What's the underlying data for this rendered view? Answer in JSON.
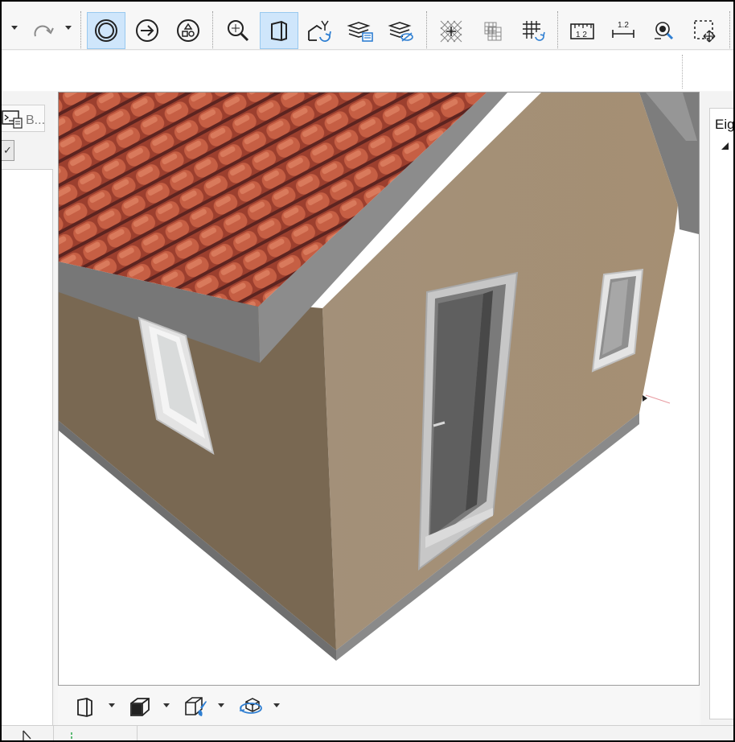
{
  "toolbar": {
    "buttons": [
      {
        "name": "redo-button",
        "icon": "redo-icon"
      },
      {
        "name": "select-circle-button",
        "icon": "circle-select-icon",
        "active": true
      },
      {
        "name": "arrow-action-button",
        "icon": "arrow-circle-icon"
      },
      {
        "name": "shapes-button",
        "icon": "shapes-icon"
      },
      {
        "name": "zoom-fit-button",
        "icon": "zoom-fit-icon"
      },
      {
        "name": "3d-view-button",
        "icon": "cube-view-icon",
        "active": true
      },
      {
        "name": "house-rotate-button",
        "icon": "house-rotate-icon"
      },
      {
        "name": "layer-settings-button",
        "icon": "layers-settings-icon"
      },
      {
        "name": "layer-visibility-button",
        "icon": "layers-eye-icon"
      },
      {
        "name": "grid-snap-button",
        "icon": "hatched-grid-icon"
      },
      {
        "name": "grid-move-button",
        "icon": "grid-move-icon"
      },
      {
        "name": "grid-refresh-button",
        "icon": "grid-refresh-icon"
      },
      {
        "name": "measure-button",
        "icon": "ruler-icon"
      },
      {
        "name": "dimension-button",
        "icon": "dimension-icon"
      },
      {
        "name": "locate-button",
        "icon": "locate-icon"
      },
      {
        "name": "selection-move-button",
        "icon": "selection-move-icon"
      }
    ],
    "measure_label": "1 2",
    "dimension_label": "1.2"
  },
  "left_panel": {
    "tab_label": "B...",
    "check_symbol": "✓"
  },
  "right_panel": {
    "title": "Eig"
  },
  "bottom_toolbar": {
    "buttons": [
      {
        "name": "view-cube-button",
        "icon": "cube-outline-icon"
      },
      {
        "name": "view-box-button",
        "icon": "box-icon"
      },
      {
        "name": "view-paint-button",
        "icon": "box-brush-icon"
      },
      {
        "name": "view-orbit-button",
        "icon": "orbit-icon"
      }
    ]
  },
  "colors": {
    "active_bg": "#cfe6fb",
    "wall_light": "#a08f78",
    "wall_dark": "#786853",
    "roof_tile": "#b8543b",
    "fascia": "#8a8a8a"
  }
}
